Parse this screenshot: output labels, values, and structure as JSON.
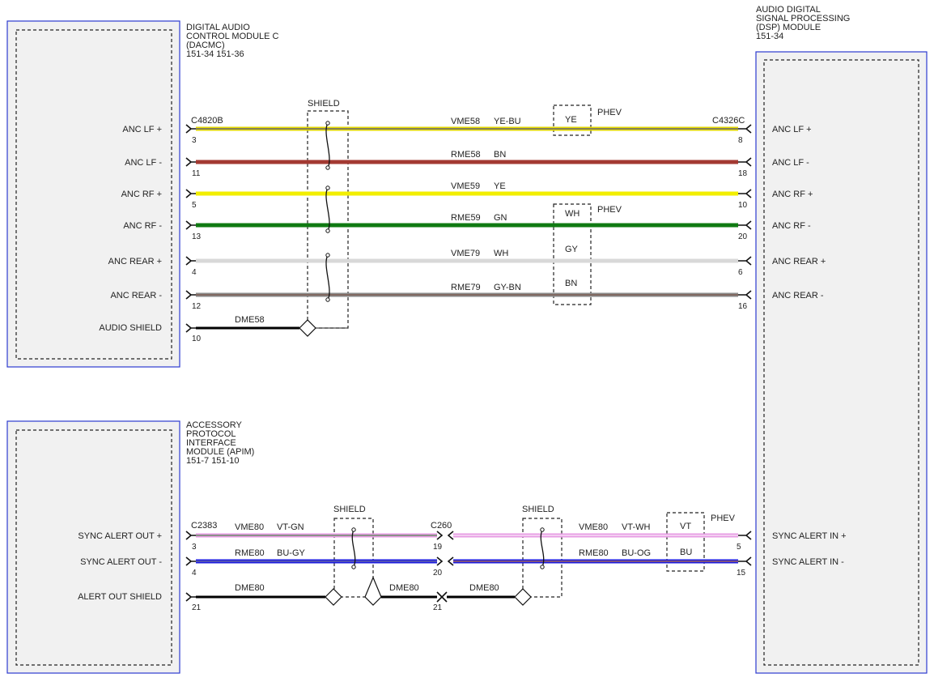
{
  "modules": {
    "dacmc": {
      "title_lines": [
        "DIGITAL AUDIO",
        "CONTROL MODULE C",
        "(DACMC)",
        "151-34  151-36"
      ]
    },
    "dsp": {
      "title_lines": [
        "AUDIO DIGITAL",
        "SIGNAL PROCESSING",
        "(DSP) MODULE",
        "151-34"
      ]
    },
    "apim": {
      "title_lines": [
        "ACCESSORY",
        "PROTOCOL",
        "INTERFACE",
        "MODULE (APIM)",
        "151-7    151-10"
      ]
    }
  },
  "connectors": {
    "c4820b": "C4820B",
    "c4326c": "C4326C",
    "c2383": "C2383",
    "c260": "C260"
  },
  "labels": {
    "shield": "SHIELD",
    "phev": "PHEV"
  },
  "top_wires": [
    {
      "left_label": "ANC LF +",
      "right_label": "ANC LF +",
      "circuit": "VME58",
      "color_code": "YE-BU",
      "left_pin": "3",
      "right_pin": "8",
      "color": "#e3d800",
      "stripe": "#2a2aa8",
      "alt": "YE"
    },
    {
      "left_label": "ANC LF -",
      "right_label": "ANC LF -",
      "circuit": "RME58",
      "color_code": "BN",
      "left_pin": "11",
      "right_pin": "18",
      "color": "#a33a32",
      "stripe": "",
      "alt": ""
    },
    {
      "left_label": "ANC RF +",
      "right_label": "ANC RF +",
      "circuit": "VME59",
      "color_code": "YE",
      "left_pin": "5",
      "right_pin": "10",
      "color": "#f2ee00",
      "stripe": "",
      "alt": ""
    },
    {
      "left_label": "ANC RF -",
      "right_label": "ANC RF -",
      "circuit": "RME59",
      "color_code": "GN",
      "left_pin": "13",
      "right_pin": "20",
      "color": "#0f7a12",
      "stripe": "",
      "alt": "WH"
    },
    {
      "left_label": "ANC REAR +",
      "right_label": "ANC REAR +",
      "circuit": "VME79",
      "color_code": "WH",
      "left_pin": "4",
      "right_pin": "6",
      "color": "#d8d8d8",
      "stripe": "",
      "alt": "GY"
    },
    {
      "left_label": "ANC REAR -",
      "right_label": "ANC REAR -",
      "circuit": "RME79",
      "color_code": "GY-BN",
      "left_pin": "12",
      "right_pin": "16",
      "color": "#8a8a8a",
      "stripe": "#7a4a3a",
      "alt": "BN"
    }
  ],
  "audio_shield": {
    "label": "AUDIO SHIELD",
    "circuit": "DME58",
    "pin": "10"
  },
  "bottom_wires": [
    {
      "left_label": "SYNC ALERT OUT +",
      "right_label": "SYNC ALERT IN +",
      "circuit_left": "VME80",
      "code_left": "VT-GN",
      "circuit_right": "VME80",
      "code_right": "VT-WH",
      "pin_left": "3",
      "pin_mid": "19",
      "pin_right": "5",
      "color": "#e79be3",
      "alt": "VT"
    },
    {
      "left_label": "SYNC ALERT OUT -",
      "right_label": "SYNC ALERT IN -",
      "circuit_left": "RME80",
      "code_left": "BU-GY",
      "circuit_right": "RME80",
      "code_right": "BU-OG",
      "pin_left": "4",
      "pin_mid": "20",
      "pin_right": "15",
      "color": "#1c1ce0",
      "alt": "BU"
    }
  ],
  "alert_shield": {
    "label": "ALERT OUT SHIELD",
    "circuit1": "DME80",
    "circuit2": "DME80",
    "circuit3": "DME80",
    "pin_left": "21",
    "pin_mid": "21"
  }
}
